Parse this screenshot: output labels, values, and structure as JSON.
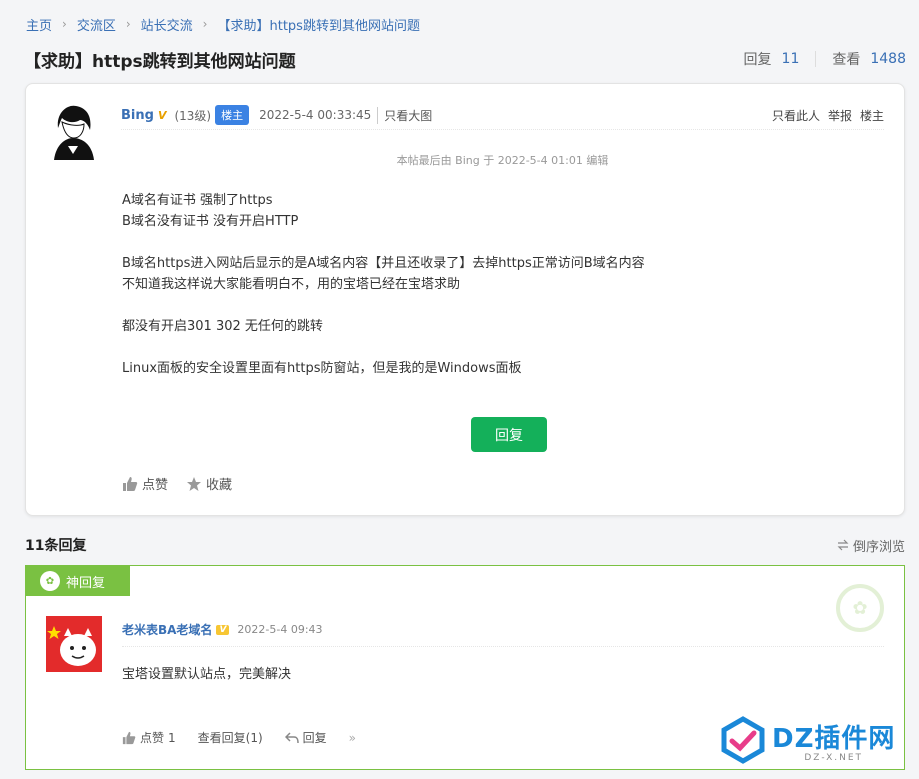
{
  "breadcrumb": {
    "items": [
      "主页",
      "交流区",
      "站长交流",
      "【求助】https跳转到其他网站问题"
    ],
    "separator": "›"
  },
  "thread": {
    "title": "【求助】https跳转到其他网站问题",
    "replies_label": "回复",
    "replies_count": "11",
    "views_label": "查看",
    "views_count": "1488"
  },
  "post": {
    "username": "Bing",
    "vip_label": "V",
    "level": "(13级)",
    "owner_badge": "楼主",
    "time": "2022-5-4 00:33:45",
    "only_images": "只看大图",
    "actions": [
      "只看此人",
      "举报",
      "楼主"
    ],
    "edit_note": "本帖最后由 Bing 于 2022-5-4 01:01 编辑",
    "body": [
      "A域名有证书 强制了https",
      "B域名没有证书 没有开启HTTP",
      "",
      "B域名https进入网站后显示的是A域名内容【并且还收录了】去掉https正常访问B域名内容",
      "不知道我这样说大家能看明白不，用的宝塔已经在宝塔求助",
      "",
      "都没有开启301  302 无任何的跳转",
      "",
      "Linux面板的安全设置里面有https防窗站，但是我的是Windows面板"
    ],
    "reply_button": "回复",
    "like_label": "点赞",
    "favorite_label": "收藏"
  },
  "replies_section": {
    "count_label": "11条回复",
    "reverse_label": "倒序浏览"
  },
  "god_reply": {
    "tag": "神回复",
    "username": "老米表BA老域名",
    "vip_label": "V",
    "time": "2022-5-4 09:43",
    "body": "宝塔设置默认站点，完美解决",
    "like_label": "点赞",
    "like_count": "1",
    "view_replies": "查看回复(1)",
    "reply_label": "回复"
  },
  "watermark": {
    "brand": "DZ插件网",
    "domain": "DZ-X.NET"
  },
  "colors": {
    "link": "#3a70b5",
    "green_button": "#14b05a",
    "god_green": "#7ac142",
    "owner_badge": "#3b82e3"
  }
}
